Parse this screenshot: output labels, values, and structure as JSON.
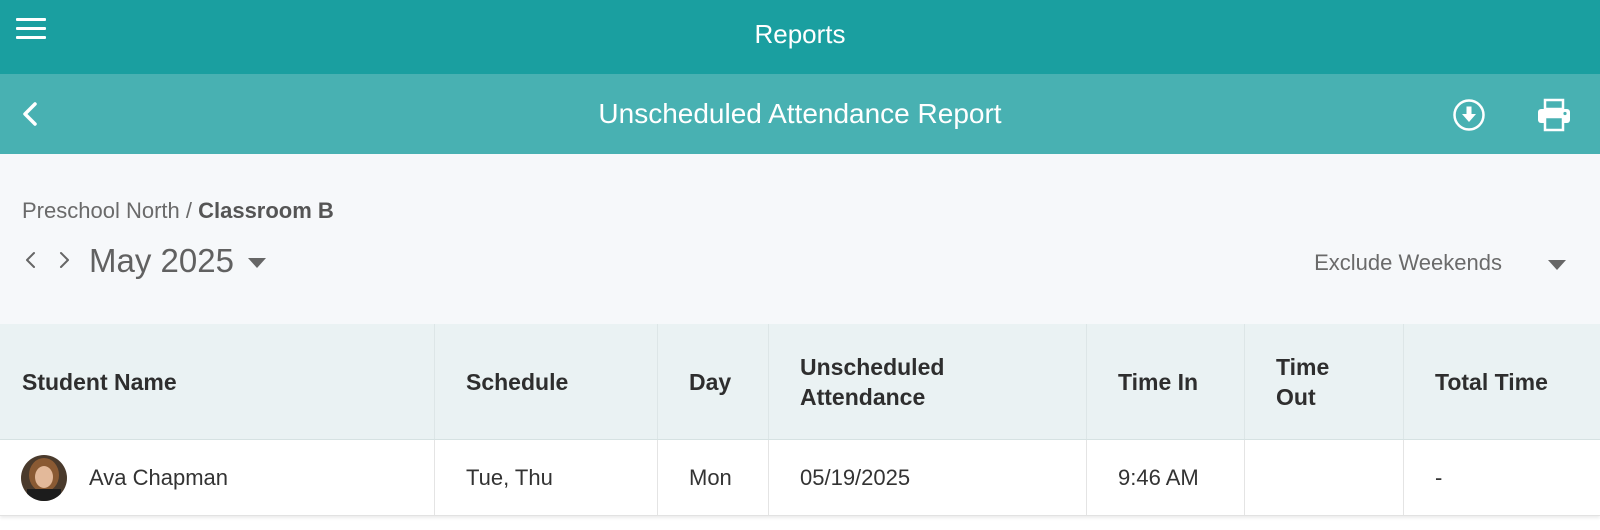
{
  "app": {
    "title": "Reports"
  },
  "report": {
    "title": "Unscheduled Attendance Report"
  },
  "breadcrumb": {
    "school": "Preschool North",
    "separator": " / ",
    "classroom": "Classroom B"
  },
  "period": {
    "month": "May 2025"
  },
  "filter": {
    "label": "Exclude Weekends"
  },
  "table": {
    "headers": {
      "student_name": "Student Name",
      "schedule": "Schedule",
      "day": "Day",
      "unscheduled_line1": "Unscheduled",
      "unscheduled_line2": "Attendance",
      "time_in": "Time In",
      "time_out_line1": "Time",
      "time_out_line2": "Out",
      "total_time": "Total Time"
    },
    "rows": [
      {
        "student_name": "Ava Chapman",
        "schedule": "Tue, Thu",
        "day": "Mon",
        "unscheduled_attendance": "05/19/2025",
        "time_in": "9:46 AM",
        "time_out": "",
        "total_time": "-"
      }
    ]
  },
  "icons": {
    "menu": "hamburger-menu-icon",
    "back": "chevron-left-icon",
    "download": "download-circle-icon",
    "print": "printer-icon",
    "prev": "chevron-left-icon",
    "next": "chevron-right-icon",
    "caret": "caret-down-icon"
  },
  "colors": {
    "top_bar": "#1a9fa0",
    "sub_bar": "#48b1b2",
    "panel": "#f6f8fa",
    "table_header": "#eaf2f3"
  }
}
